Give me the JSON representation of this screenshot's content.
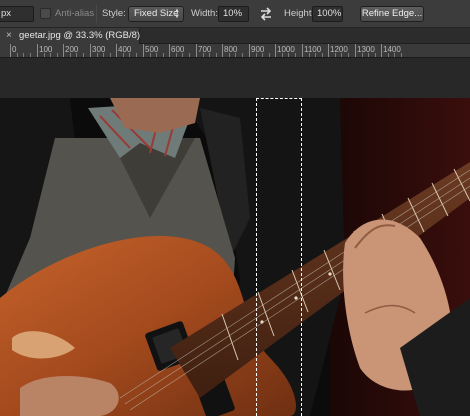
{
  "options_bar": {
    "unit_value": "px",
    "anti_alias_label": "Anti-alias",
    "style_label": "Style:",
    "style_value": "Fixed Size",
    "width_label": "Width:",
    "width_value": "10%",
    "height_label": "Height:",
    "height_value": "100%",
    "refine_edge_label": "Refine Edge..."
  },
  "document_tab": {
    "close_glyph": "×",
    "title": "geetar.jpg @ 33.3% (RGB/8)"
  },
  "ruler": {
    "labels": [
      "0",
      "100",
      "200",
      "300",
      "400",
      "500",
      "600",
      "700",
      "800",
      "900",
      "1000",
      "1100",
      "1200",
      "1300",
      "1400"
    ]
  },
  "icons": {
    "swap": "swap-arrows-icon",
    "close": "close-icon"
  },
  "colors": {
    "options_bar_bg": "#3c3c3c",
    "canvas_bg": "#282828",
    "marquee": "#ffffff"
  }
}
